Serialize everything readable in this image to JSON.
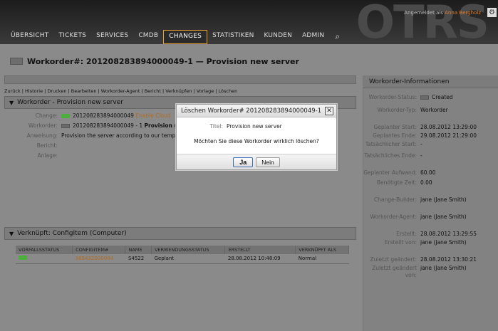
{
  "header": {
    "logo": "OTRS",
    "logged_in_prefix": "Angemeldet als",
    "logged_in_user": "Anna Bergholz",
    "nav": [
      "ÜBERSICHT",
      "TICKETS",
      "SERVICES",
      "CMDB",
      "CHANGES",
      "STATISTIKEN",
      "KUNDEN",
      "ADMIN"
    ],
    "active_nav": "CHANGES"
  },
  "page_title": "Workorder#: 201208283894000049-1 — Provision new server",
  "actions": "Zurück | Historie | Drucken | Bearbeiten | Workorder-Agent | Bericht | Verknüpfen | Vorlage | Löschen",
  "workorder_section": {
    "heading": "Workorder - Provision new server",
    "fields": [
      {
        "label": "Change:",
        "value": "201208283894000049",
        "extra": "Enable Cloud",
        "swatch": "green"
      },
      {
        "label": "Workorder:",
        "value": "201208283894000049 - 1",
        "extra": "Provision n",
        "swatch": "gray"
      },
      {
        "label": "Anweisung:",
        "value": "Provision the server according to our temp",
        "extra": "",
        "swatch": ""
      },
      {
        "label": "Bericht:",
        "value": "",
        "extra": "",
        "swatch": ""
      },
      {
        "label": "Anlage:",
        "value": "",
        "extra": "",
        "swatch": ""
      }
    ]
  },
  "linked": {
    "heading": "Verknüpft: ConfigItem (Computer)",
    "columns": [
      "VORFALLSSTATUS",
      "CONFIGITEM#",
      "NAME",
      "VERWENDUNGSSTATUS",
      "ERSTELLT",
      "VERKNÜPFT ALS"
    ],
    "rows": [
      [
        "",
        "389432000004",
        "S4522",
        "Geplant",
        "28.08.2012 10:48:09",
        "Normal"
      ]
    ]
  },
  "sidebar": {
    "heading": "Workorder-Informationen",
    "rows": [
      {
        "label": "Workorder-Status:",
        "value": "Created"
      },
      {
        "label": "Workorder-Typ:",
        "value": "Workorder"
      },
      {
        "label": "Geplanter Start:",
        "value": "28.08.2012 13:29:00"
      },
      {
        "label": "Geplantes Ende:",
        "value": "29.08.2012 21:29:00"
      },
      {
        "label": "Tatsächlicher Start:",
        "value": "-"
      },
      {
        "label": "Tatsächliches Ende:",
        "value": "-"
      },
      {
        "label": "Geplanter Aufwand:",
        "value": "60.00"
      },
      {
        "label": "Benötigte Zeit:",
        "value": "0.00"
      },
      {
        "label": "Change-Builder:",
        "value": "jane (Jane Smith)"
      },
      {
        "label": "Workorder-Agent:",
        "value": "jane (Jane Smith)"
      },
      {
        "label": "Erstellt:",
        "value": "28.08.2012 13:29:55"
      },
      {
        "label": "Erstellt von:",
        "value": "jane (Jane Smith)"
      },
      {
        "label": "Zuletzt geändert:",
        "value": "28.08.2012 13:30:21"
      },
      {
        "label": "Zuletzt geändert von:",
        "value": "jane (Jane Smith)"
      }
    ]
  },
  "dialog": {
    "title": "Löschen Workorder# 201208283894000049-1",
    "title_label": "Titel:",
    "title_value": "Provision new server",
    "question": "Möchten Sie diese Workorder wirklich löschen?",
    "yes": "Ja",
    "no": "Nein"
  }
}
